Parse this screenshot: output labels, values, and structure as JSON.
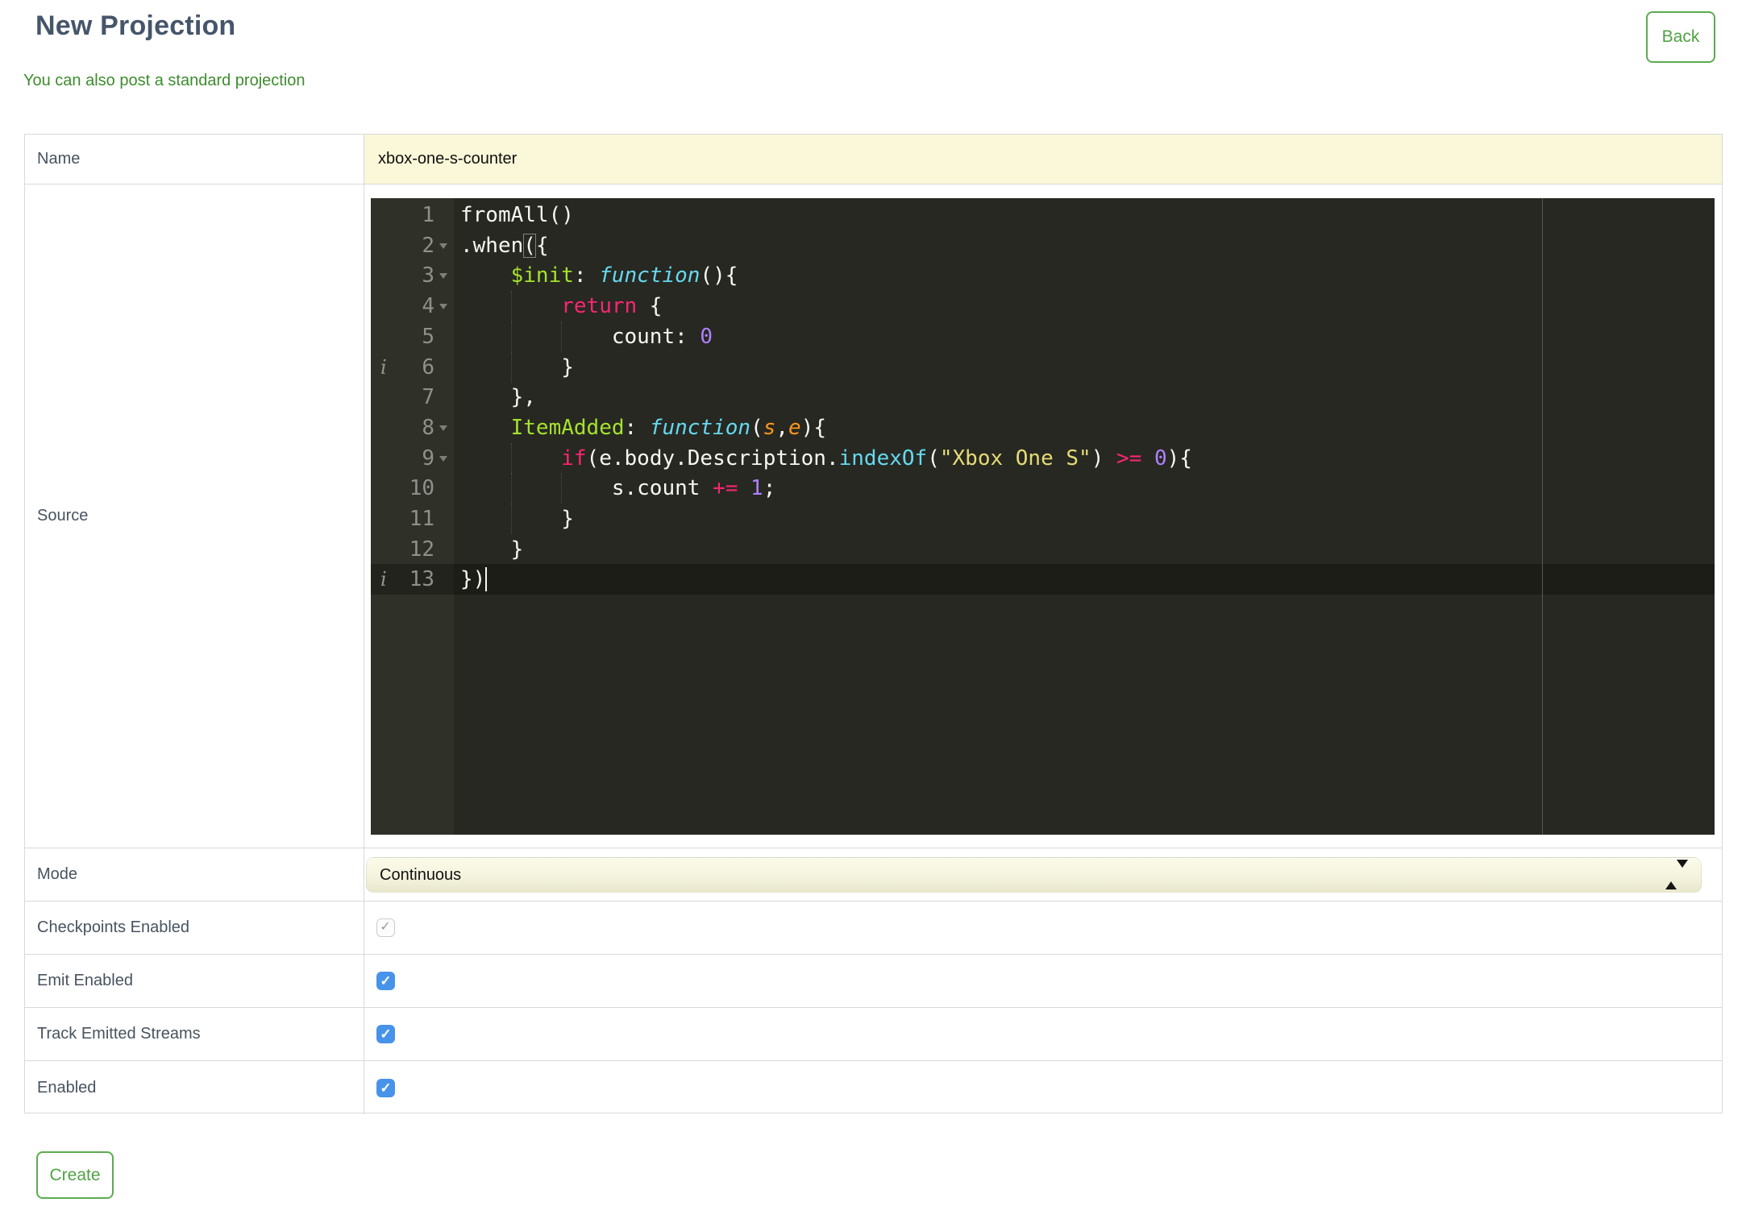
{
  "page": {
    "title": "New Projection",
    "back_label": "Back",
    "standard_projection_link": "You can also post a standard projection",
    "create_label": "Create"
  },
  "form": {
    "name": {
      "label": "Name",
      "value": "xbox-one-s-counter"
    },
    "source": {
      "label": "Source"
    },
    "mode": {
      "label": "Mode",
      "value": "Continuous"
    },
    "checkboxes": [
      {
        "label": "Checkpoints Enabled",
        "checked": true,
        "disabled": true
      },
      {
        "label": "Emit Enabled",
        "checked": true,
        "disabled": false
      },
      {
        "label": "Track Emitted Streams",
        "checked": true,
        "disabled": false
      },
      {
        "label": "Enabled",
        "checked": true,
        "disabled": false
      }
    ]
  },
  "editor": {
    "language": "javascript",
    "cursor": {
      "line": 13,
      "col": 2
    },
    "colors": {
      "background": "#272822",
      "gutter": "#2F3129",
      "active_line": "#1C1D17",
      "plain": "#F8F8F2",
      "keyword": "#F92672",
      "function_name": "#A6E22E",
      "storage_type": "#66D9EF",
      "param": "#FD971F",
      "number": "#AE81FF",
      "string": "#E6DB74",
      "line_number": "#8F908A",
      "accent_green": "#5CAB4F",
      "link_green": "#3D8C2E",
      "checkbox_blue": "#4793E9",
      "field_yellow": "#FAF8D8"
    },
    "lines": [
      {
        "num": 1,
        "fold": false,
        "info": false,
        "active": false,
        "tokens": [
          {
            "t": "fromAll()",
            "c": "pl"
          }
        ]
      },
      {
        "num": 2,
        "fold": true,
        "info": false,
        "active": false,
        "tokens": [
          {
            "t": ".when",
            "c": "pl"
          },
          {
            "t": "(",
            "c": "br"
          },
          {
            "t": "{",
            "c": "pl"
          }
        ]
      },
      {
        "num": 3,
        "fold": true,
        "info": false,
        "active": false,
        "tokens": [
          {
            "t": "    ",
            "c": "pl"
          },
          {
            "t": "$init",
            "c": "fn"
          },
          {
            "t": ": ",
            "c": "pl"
          },
          {
            "t": "function",
            "c": "st"
          },
          {
            "t": "(){",
            "c": "pl"
          }
        ]
      },
      {
        "num": 4,
        "fold": true,
        "info": false,
        "active": false,
        "tokens": [
          {
            "t": "        ",
            "c": "pl"
          },
          {
            "t": "return",
            "c": "kw"
          },
          {
            "t": " {",
            "c": "pl"
          }
        ]
      },
      {
        "num": 5,
        "fold": false,
        "info": false,
        "active": false,
        "tokens": [
          {
            "t": "            count: ",
            "c": "pl"
          },
          {
            "t": "0",
            "c": "nu"
          }
        ]
      },
      {
        "num": 6,
        "fold": false,
        "info": true,
        "active": false,
        "tokens": [
          {
            "t": "        }",
            "c": "pl"
          }
        ]
      },
      {
        "num": 7,
        "fold": false,
        "info": false,
        "active": false,
        "tokens": [
          {
            "t": "    },",
            "c": "pl"
          }
        ]
      },
      {
        "num": 8,
        "fold": true,
        "info": false,
        "active": false,
        "tokens": [
          {
            "t": "    ",
            "c": "pl"
          },
          {
            "t": "ItemAdded",
            "c": "fn"
          },
          {
            "t": ": ",
            "c": "pl"
          },
          {
            "t": "function",
            "c": "st"
          },
          {
            "t": "(",
            "c": "pl"
          },
          {
            "t": "s",
            "c": "pa"
          },
          {
            "t": ",",
            "c": "pl"
          },
          {
            "t": "e",
            "c": "pa"
          },
          {
            "t": "){",
            "c": "pl"
          }
        ]
      },
      {
        "num": 9,
        "fold": true,
        "info": false,
        "active": false,
        "tokens": [
          {
            "t": "        ",
            "c": "pl"
          },
          {
            "t": "if",
            "c": "kw"
          },
          {
            "t": "(e.body.Description.",
            "c": "pl"
          },
          {
            "t": "indexOf",
            "c": "su"
          },
          {
            "t": "(",
            "c": "pl"
          },
          {
            "t": "\"Xbox One S\"",
            "c": "str"
          },
          {
            "t": ") ",
            "c": "pl"
          },
          {
            "t": ">=",
            "c": "kw"
          },
          {
            "t": " ",
            "c": "pl"
          },
          {
            "t": "0",
            "c": "nu"
          },
          {
            "t": "){",
            "c": "pl"
          }
        ]
      },
      {
        "num": 10,
        "fold": false,
        "info": false,
        "active": false,
        "tokens": [
          {
            "t": "            s.count ",
            "c": "pl"
          },
          {
            "t": "+=",
            "c": "kw"
          },
          {
            "t": " ",
            "c": "pl"
          },
          {
            "t": "1",
            "c": "nu"
          },
          {
            "t": ";",
            "c": "pl"
          }
        ]
      },
      {
        "num": 11,
        "fold": false,
        "info": false,
        "active": false,
        "tokens": [
          {
            "t": "        }",
            "c": "pl"
          }
        ]
      },
      {
        "num": 12,
        "fold": false,
        "info": false,
        "active": false,
        "tokens": [
          {
            "t": "    }",
            "c": "pl"
          }
        ]
      },
      {
        "num": 13,
        "fold": false,
        "info": true,
        "active": true,
        "tokens": [
          {
            "t": "})",
            "c": "pl"
          }
        ]
      }
    ]
  }
}
